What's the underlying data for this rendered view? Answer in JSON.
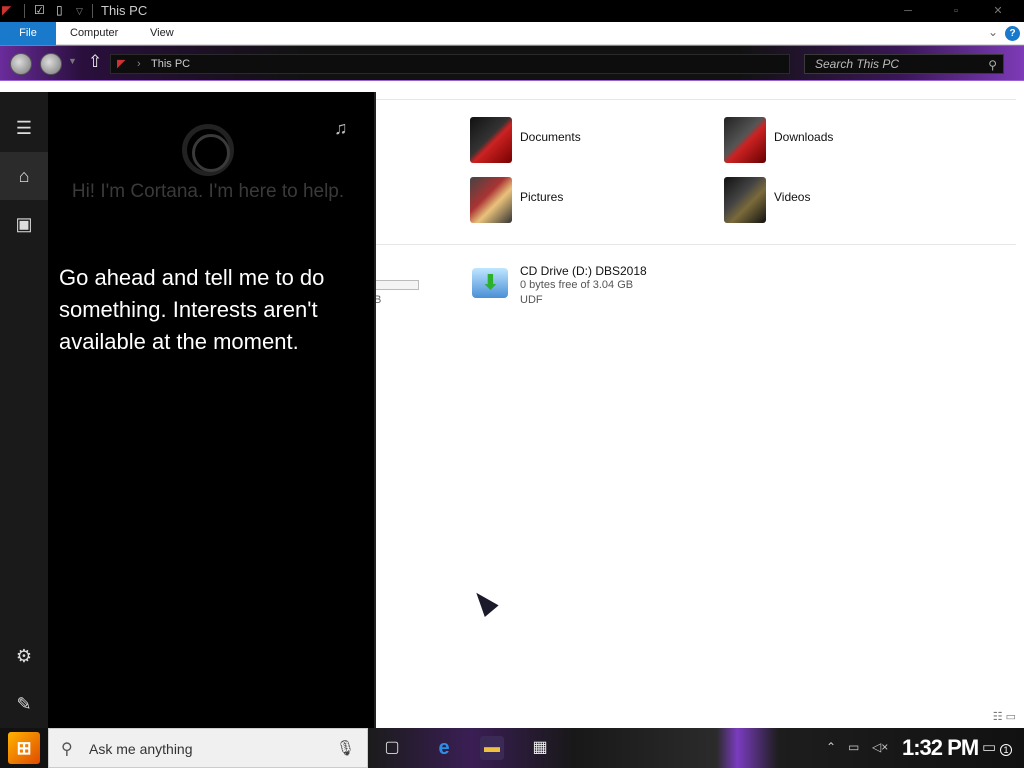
{
  "window": {
    "title": "This PC"
  },
  "ribbon": {
    "tabs": [
      "File",
      "Computer",
      "View"
    ],
    "help": "?"
  },
  "address": {
    "path": "This PC",
    "search_placeholder": "Search This PC"
  },
  "folders": [
    {
      "label": "Documents",
      "icon": "documents-folder-icon"
    },
    {
      "label": "Downloads",
      "icon": "downloads-folder-icon"
    },
    {
      "label": "Pictures",
      "icon": "pictures-folder-icon"
    },
    {
      "label": "Videos",
      "icon": "videos-folder-icon"
    }
  ],
  "drive": {
    "name": "CD Drive (D:) DBS2018",
    "free": "0 bytes free of 3.04 GB",
    "fs": "UDF",
    "partial_label": "B"
  },
  "cortana": {
    "greeting": "Hi! I'm Cortana. I'm here to help.",
    "message": "Go ahead and tell me to do something. Interests aren't available at the moment."
  },
  "taskbar": {
    "search_placeholder": "Ask me anything",
    "clock": "1:32 PM",
    "notification_count": "1"
  },
  "colors": {
    "accent": "#1979ca",
    "theme_purple": "#7d3bb7"
  }
}
